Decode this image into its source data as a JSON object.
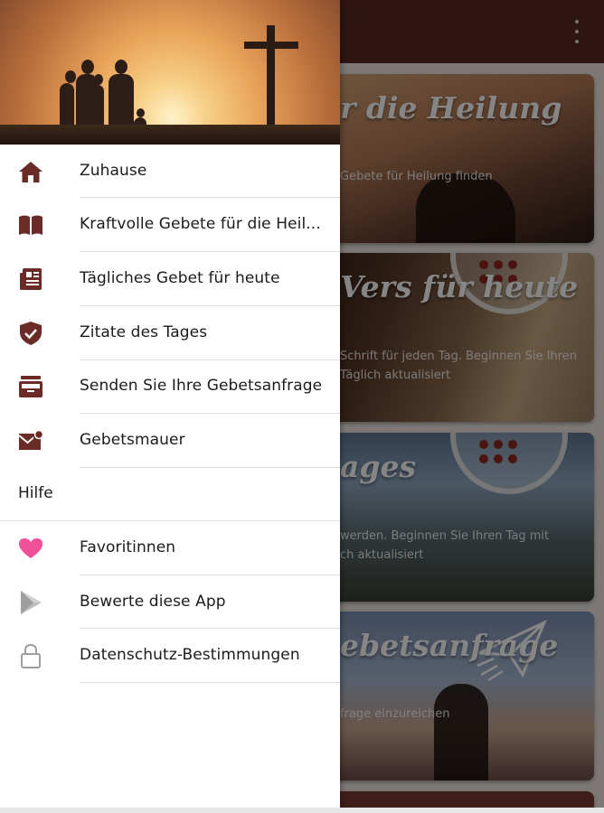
{
  "app": {
    "cards": [
      {
        "title": "r die Heilung",
        "desc": [
          "Gebete für Heilung finden"
        ]
      },
      {
        "title": "Vers für heute",
        "desc": [
          "Schrift für jeden Tag. Beginnen Sie Ihren",
          "Täglich aktualisiert"
        ]
      },
      {
        "title": "ages",
        "desc": [
          "werden. Beginnen Sie Ihren Tag mit",
          "ch aktualisiert"
        ]
      },
      {
        "title": "ebetsanfrage",
        "desc": [
          "frage einzureichen"
        ]
      }
    ]
  },
  "drawer": {
    "items": [
      {
        "icon": "home-icon",
        "label": "Zuhause"
      },
      {
        "icon": "book-icon",
        "label": "Kraftvolle Gebete für die Heil..."
      },
      {
        "icon": "newspaper-icon",
        "label": "Tägliches Gebet für heute"
      },
      {
        "icon": "shield-check-icon",
        "label": "Zitate des Tages"
      },
      {
        "icon": "inbox-icon",
        "label": "Senden Sie Ihre Gebetsanfrage"
      },
      {
        "icon": "mail-notification-icon",
        "label": "Gebetsmauer"
      }
    ],
    "section_label": "Hilfe",
    "help_items": [
      {
        "icon": "heart-icon",
        "label": "Favoritinnen"
      },
      {
        "icon": "play-store-icon",
        "label": "Bewerte diese App"
      },
      {
        "icon": "lock-icon",
        "label": "Datenschutz-Bestimmungen"
      }
    ]
  },
  "colors": {
    "primary": "#5b2a24",
    "nav_icon": "#6b2b26",
    "heart": "#f0509a",
    "muted_icon": "#9e9e9e"
  }
}
